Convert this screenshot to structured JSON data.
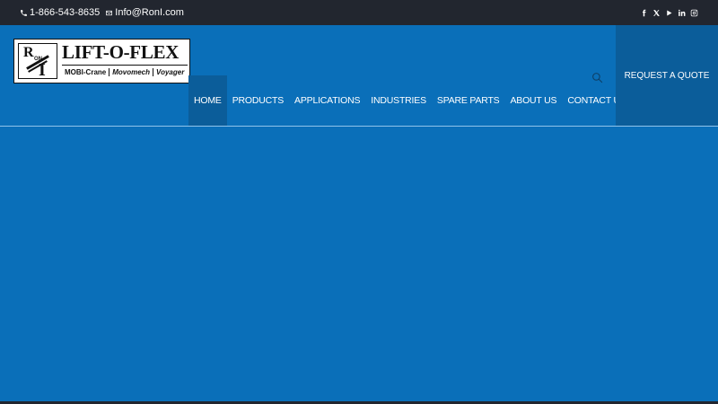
{
  "topbar": {
    "phone": "1-866-543-8635",
    "email": "Info@RonI.com",
    "socials": [
      "facebook-icon",
      "x-icon",
      "youtube-icon",
      "linkedin-icon",
      "instagram-icon"
    ]
  },
  "logo": {
    "letters_r": "R",
    "letters_on": "ON",
    "letters_i": "I",
    "name": "LIFT-O-FLEX",
    "brands": [
      "MOBI-Crane",
      "Movomech",
      "Voyager"
    ]
  },
  "nav": {
    "items": [
      "HOME",
      "PRODUCTS",
      "APPLICATIONS",
      "INDUSTRIES",
      "SPARE PARTS",
      "ABOUT US",
      "CONTACT US"
    ],
    "active": "HOME"
  },
  "quote_button": "REQUEST A QUOTE",
  "colors": {
    "topbar": "#22262f",
    "primary": "#0a6fb9",
    "active": "#0b5d9a"
  }
}
